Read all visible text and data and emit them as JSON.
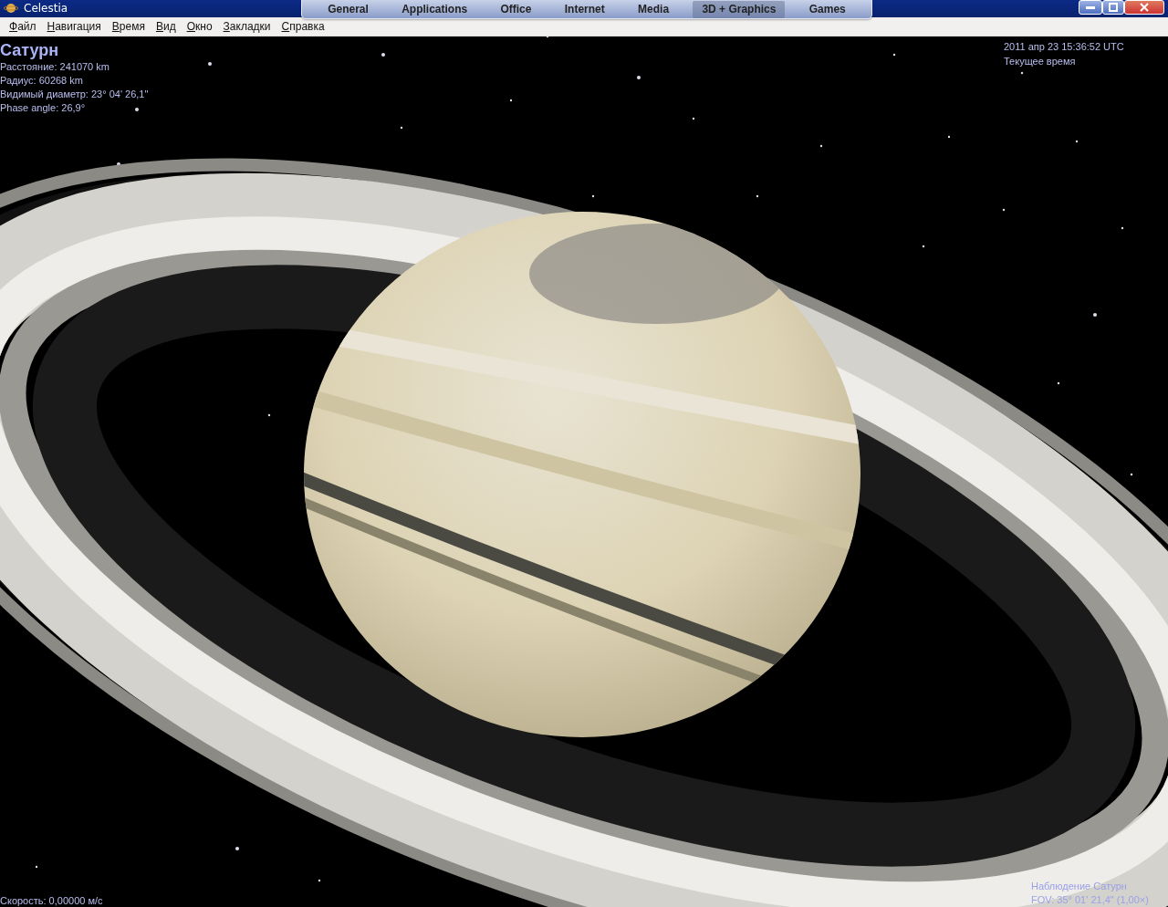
{
  "window": {
    "title": "Celestia"
  },
  "launcher_tabs": [
    {
      "label": "General",
      "selected": false
    },
    {
      "label": "Applications",
      "selected": false
    },
    {
      "label": "Office",
      "selected": false
    },
    {
      "label": "Internet",
      "selected": false
    },
    {
      "label": "Media",
      "selected": false
    },
    {
      "label": "3D + Graphics",
      "selected": true
    },
    {
      "label": "Games",
      "selected": false
    }
  ],
  "menu": [
    "Файл",
    "Навигация",
    "Время",
    "Вид",
    "Окно",
    "Закладки",
    "Справка"
  ],
  "object_info": {
    "name": "Сатурн",
    "lines": [
      "Расстояние: 241070 km",
      "Радиус: 60268 km",
      "Видимый диаметр: 23° 04' 26,1\"",
      "Phase angle: 26,9°"
    ]
  },
  "time_info": {
    "datetime": "2011 апр 23 15:36:52 UTC",
    "mode": "Текущее время"
  },
  "speed": "Скорость: 0,00000 м/с",
  "view_info": {
    "target": "Наблюдение Сатурн",
    "fov": "FOV: 35° 01' 21,4\" (1,00×)"
  }
}
